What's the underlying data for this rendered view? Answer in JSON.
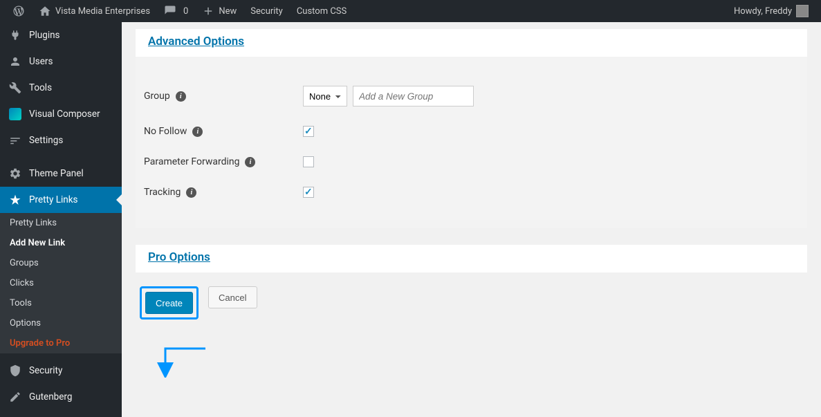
{
  "adminbar": {
    "site_name": "Vista Media Enterprises",
    "comments_count": "0",
    "new_label": "New",
    "security_label": "Security",
    "custom_css_label": "Custom CSS",
    "greeting": "Howdy, Freddy"
  },
  "sidebar": {
    "plugins": "Plugins",
    "users": "Users",
    "tools": "Tools",
    "visual_composer": "Visual Composer",
    "settings": "Settings",
    "theme_panel": "Theme Panel",
    "pretty_links": "Pretty Links",
    "security": "Security",
    "gutenberg": "Gutenberg"
  },
  "submenu": {
    "pretty_links": "Pretty Links",
    "add_new_link": "Add New Link",
    "groups": "Groups",
    "clicks": "Clicks",
    "tools": "Tools",
    "options": "Options",
    "upgrade": "Upgrade to Pro"
  },
  "panel": {
    "advanced_options_title": "Advanced Options",
    "pro_options_title": "Pro Options",
    "rows": {
      "group": {
        "label": "Group",
        "select_value": "None",
        "placeholder": "Add a New Group"
      },
      "no_follow": {
        "label": "No Follow",
        "checked": true
      },
      "param_forward": {
        "label": "Parameter Forwarding",
        "checked": false
      },
      "tracking": {
        "label": "Tracking",
        "checked": true
      }
    },
    "buttons": {
      "create": "Create",
      "cancel": "Cancel"
    }
  }
}
